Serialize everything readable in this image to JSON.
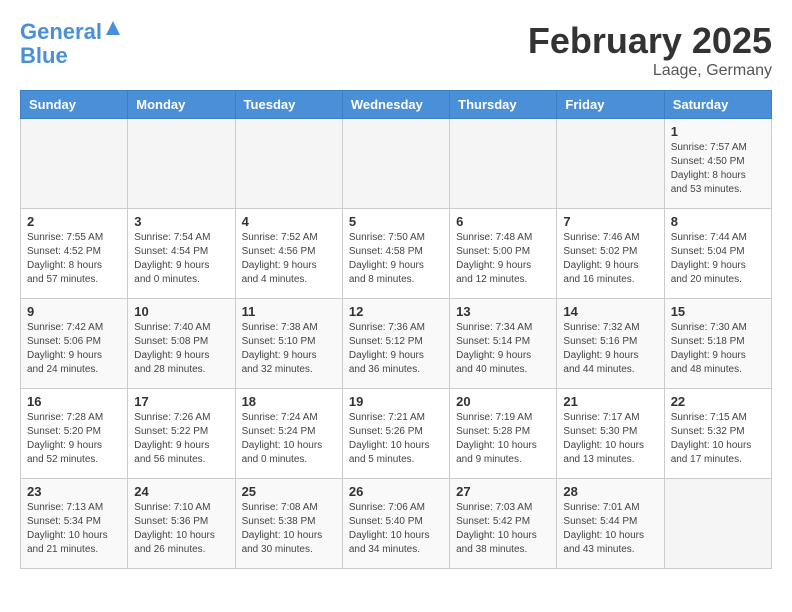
{
  "header": {
    "logo_line1": "General",
    "logo_line2": "Blue",
    "month": "February 2025",
    "location": "Laage, Germany"
  },
  "weekdays": [
    "Sunday",
    "Monday",
    "Tuesday",
    "Wednesday",
    "Thursday",
    "Friday",
    "Saturday"
  ],
  "weeks": [
    [
      {
        "day": "",
        "info": ""
      },
      {
        "day": "",
        "info": ""
      },
      {
        "day": "",
        "info": ""
      },
      {
        "day": "",
        "info": ""
      },
      {
        "day": "",
        "info": ""
      },
      {
        "day": "",
        "info": ""
      },
      {
        "day": "1",
        "info": "Sunrise: 7:57 AM\nSunset: 4:50 PM\nDaylight: 8 hours and 53 minutes."
      }
    ],
    [
      {
        "day": "2",
        "info": "Sunrise: 7:55 AM\nSunset: 4:52 PM\nDaylight: 8 hours and 57 minutes."
      },
      {
        "day": "3",
        "info": "Sunrise: 7:54 AM\nSunset: 4:54 PM\nDaylight: 9 hours and 0 minutes."
      },
      {
        "day": "4",
        "info": "Sunrise: 7:52 AM\nSunset: 4:56 PM\nDaylight: 9 hours and 4 minutes."
      },
      {
        "day": "5",
        "info": "Sunrise: 7:50 AM\nSunset: 4:58 PM\nDaylight: 9 hours and 8 minutes."
      },
      {
        "day": "6",
        "info": "Sunrise: 7:48 AM\nSunset: 5:00 PM\nDaylight: 9 hours and 12 minutes."
      },
      {
        "day": "7",
        "info": "Sunrise: 7:46 AM\nSunset: 5:02 PM\nDaylight: 9 hours and 16 minutes."
      },
      {
        "day": "8",
        "info": "Sunrise: 7:44 AM\nSunset: 5:04 PM\nDaylight: 9 hours and 20 minutes."
      }
    ],
    [
      {
        "day": "9",
        "info": "Sunrise: 7:42 AM\nSunset: 5:06 PM\nDaylight: 9 hours and 24 minutes."
      },
      {
        "day": "10",
        "info": "Sunrise: 7:40 AM\nSunset: 5:08 PM\nDaylight: 9 hours and 28 minutes."
      },
      {
        "day": "11",
        "info": "Sunrise: 7:38 AM\nSunset: 5:10 PM\nDaylight: 9 hours and 32 minutes."
      },
      {
        "day": "12",
        "info": "Sunrise: 7:36 AM\nSunset: 5:12 PM\nDaylight: 9 hours and 36 minutes."
      },
      {
        "day": "13",
        "info": "Sunrise: 7:34 AM\nSunset: 5:14 PM\nDaylight: 9 hours and 40 minutes."
      },
      {
        "day": "14",
        "info": "Sunrise: 7:32 AM\nSunset: 5:16 PM\nDaylight: 9 hours and 44 minutes."
      },
      {
        "day": "15",
        "info": "Sunrise: 7:30 AM\nSunset: 5:18 PM\nDaylight: 9 hours and 48 minutes."
      }
    ],
    [
      {
        "day": "16",
        "info": "Sunrise: 7:28 AM\nSunset: 5:20 PM\nDaylight: 9 hours and 52 minutes."
      },
      {
        "day": "17",
        "info": "Sunrise: 7:26 AM\nSunset: 5:22 PM\nDaylight: 9 hours and 56 minutes."
      },
      {
        "day": "18",
        "info": "Sunrise: 7:24 AM\nSunset: 5:24 PM\nDaylight: 10 hours and 0 minutes."
      },
      {
        "day": "19",
        "info": "Sunrise: 7:21 AM\nSunset: 5:26 PM\nDaylight: 10 hours and 5 minutes."
      },
      {
        "day": "20",
        "info": "Sunrise: 7:19 AM\nSunset: 5:28 PM\nDaylight: 10 hours and 9 minutes."
      },
      {
        "day": "21",
        "info": "Sunrise: 7:17 AM\nSunset: 5:30 PM\nDaylight: 10 hours and 13 minutes."
      },
      {
        "day": "22",
        "info": "Sunrise: 7:15 AM\nSunset: 5:32 PM\nDaylight: 10 hours and 17 minutes."
      }
    ],
    [
      {
        "day": "23",
        "info": "Sunrise: 7:13 AM\nSunset: 5:34 PM\nDaylight: 10 hours and 21 minutes."
      },
      {
        "day": "24",
        "info": "Sunrise: 7:10 AM\nSunset: 5:36 PM\nDaylight: 10 hours and 26 minutes."
      },
      {
        "day": "25",
        "info": "Sunrise: 7:08 AM\nSunset: 5:38 PM\nDaylight: 10 hours and 30 minutes."
      },
      {
        "day": "26",
        "info": "Sunrise: 7:06 AM\nSunset: 5:40 PM\nDaylight: 10 hours and 34 minutes."
      },
      {
        "day": "27",
        "info": "Sunrise: 7:03 AM\nSunset: 5:42 PM\nDaylight: 10 hours and 38 minutes."
      },
      {
        "day": "28",
        "info": "Sunrise: 7:01 AM\nSunset: 5:44 PM\nDaylight: 10 hours and 43 minutes."
      },
      {
        "day": "",
        "info": ""
      }
    ]
  ]
}
